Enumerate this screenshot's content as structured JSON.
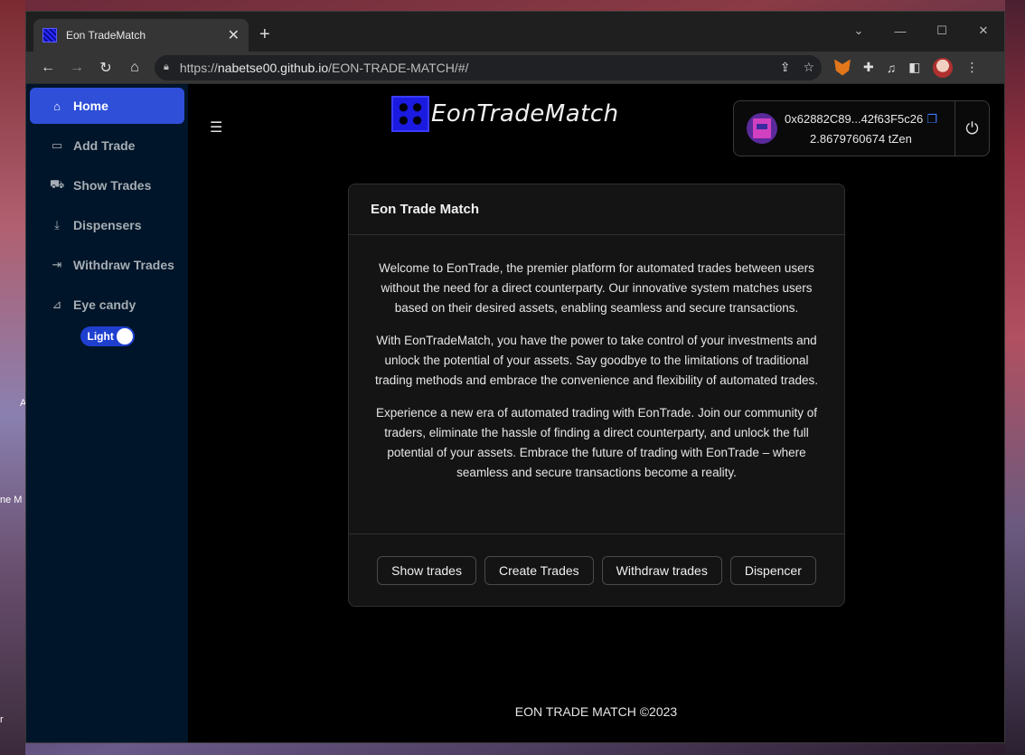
{
  "browser": {
    "tab_title": "Eon TradeMatch",
    "tab_close": "✕",
    "new_tab": "+",
    "url_scheme": "https://",
    "url_host": "nabetse00.github.io",
    "url_path": "/EON-TRADE-MATCH/#/"
  },
  "sidebar": {
    "items": [
      {
        "label": "Home",
        "icon": "home-icon",
        "glyph": "⌂"
      },
      {
        "label": "Add Trade",
        "icon": "card-icon",
        "glyph": "▭"
      },
      {
        "label": "Show Trades",
        "icon": "cart-icon",
        "glyph": "⛟"
      },
      {
        "label": "Dispensers",
        "icon": "download-icon",
        "glyph": "⤓"
      },
      {
        "label": "Withdraw Trades",
        "icon": "logout-icon",
        "glyph": "⇥"
      },
      {
        "label": "Eye candy",
        "icon": "chart-icon",
        "glyph": "⊿"
      }
    ],
    "theme_toggle_label": "Light"
  },
  "header": {
    "logo_text": "EonTradeMatch",
    "wallet_address": "0x62882C89...42f63F5c26",
    "wallet_balance": "2.8679760674 tZen"
  },
  "card": {
    "title": "Eon Trade Match",
    "paragraphs": [
      "Welcome to EonTrade, the premier platform for automated trades between users without the need for a direct counterparty. Our innovative system matches users based on their desired assets, enabling seamless and secure transactions.",
      "With EonTradeMatch, you have the power to take control of your investments and unlock the potential of your assets. Say goodbye to the limitations of traditional trading methods and embrace the convenience and flexibility of automated trades.",
      "Experience a new era of automated trading with EonTrade. Join our community of traders, eliminate the hassle of finding a direct counterparty, and unlock the full potential of your assets. Embrace the future of trading with EonTrade – where seamless and secure transactions become a reality."
    ],
    "buttons": [
      "Show trades",
      "Create Trades",
      "Withdraw trades",
      "Dispencer"
    ]
  },
  "footer": {
    "text": "EON TRADE MATCH ©2023"
  },
  "desktop": {
    "left_text_1": "A",
    "left_text_2": "ne M",
    "left_text_3": "r"
  },
  "colors": {
    "sidebar_bg": "#001529",
    "active_item": "#2f4fd8",
    "toggle": "#1f3fcf"
  }
}
